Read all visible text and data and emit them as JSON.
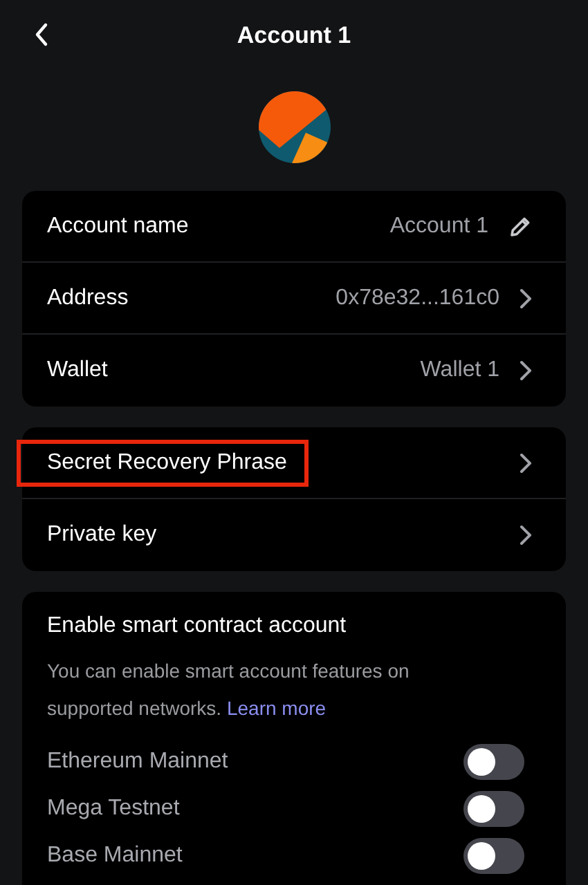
{
  "header": {
    "title": "Account 1"
  },
  "account_details": [
    {
      "kind": "edit",
      "label": "Account name",
      "value": "Account 1"
    },
    {
      "kind": "link",
      "label": "Address",
      "value": "0x78e32...161c0"
    },
    {
      "kind": "link",
      "label": "Wallet",
      "value": "Wallet 1"
    }
  ],
  "security": [
    {
      "label": "Secret Recovery Phrase",
      "highlighted": true
    },
    {
      "label": "Private key",
      "highlighted": false
    }
  ],
  "smart_account": {
    "title": "Enable smart contract account",
    "description": "You can enable smart account features on supported networks.",
    "link": "Learn more",
    "networks": [
      {
        "name": "Ethereum Mainnet",
        "on": false
      },
      {
        "name": "Mega Testnet",
        "on": false
      },
      {
        "name": "Base Mainnet",
        "on": false
      }
    ]
  }
}
